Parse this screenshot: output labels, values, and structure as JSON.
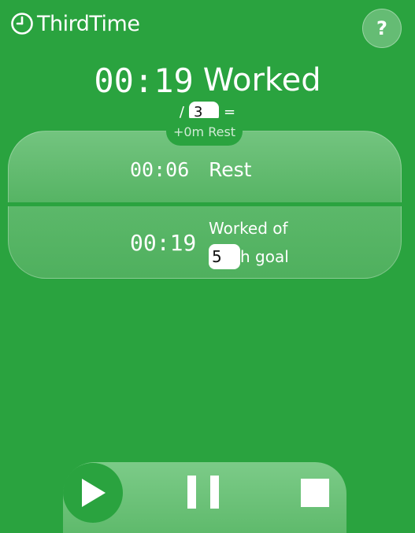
{
  "app": {
    "name": "ThirdTime",
    "logo_icon": "clock-icon"
  },
  "header": {
    "help_label": "?",
    "help_icon": "question-mark-icon"
  },
  "timer": {
    "worked_time": "00:19",
    "worked_label": "Worked",
    "divider_prefix": "/",
    "divisor_value": "3",
    "divider_suffix": "=",
    "rest_added": "+0m Rest"
  },
  "rest_card": {
    "time": "00:06",
    "label": "Rest"
  },
  "goal_card": {
    "time": "00:19",
    "label_line1": "Worked of",
    "goal_value": "5",
    "label_line2_suffix": "h goal"
  },
  "controls": {
    "play_icon": "play-icon",
    "pause_icon": "pause-icon",
    "stop_icon": "stop-icon"
  },
  "colors": {
    "background": "#2aa33f",
    "card": "#62b86f",
    "text": "#ffffff"
  }
}
